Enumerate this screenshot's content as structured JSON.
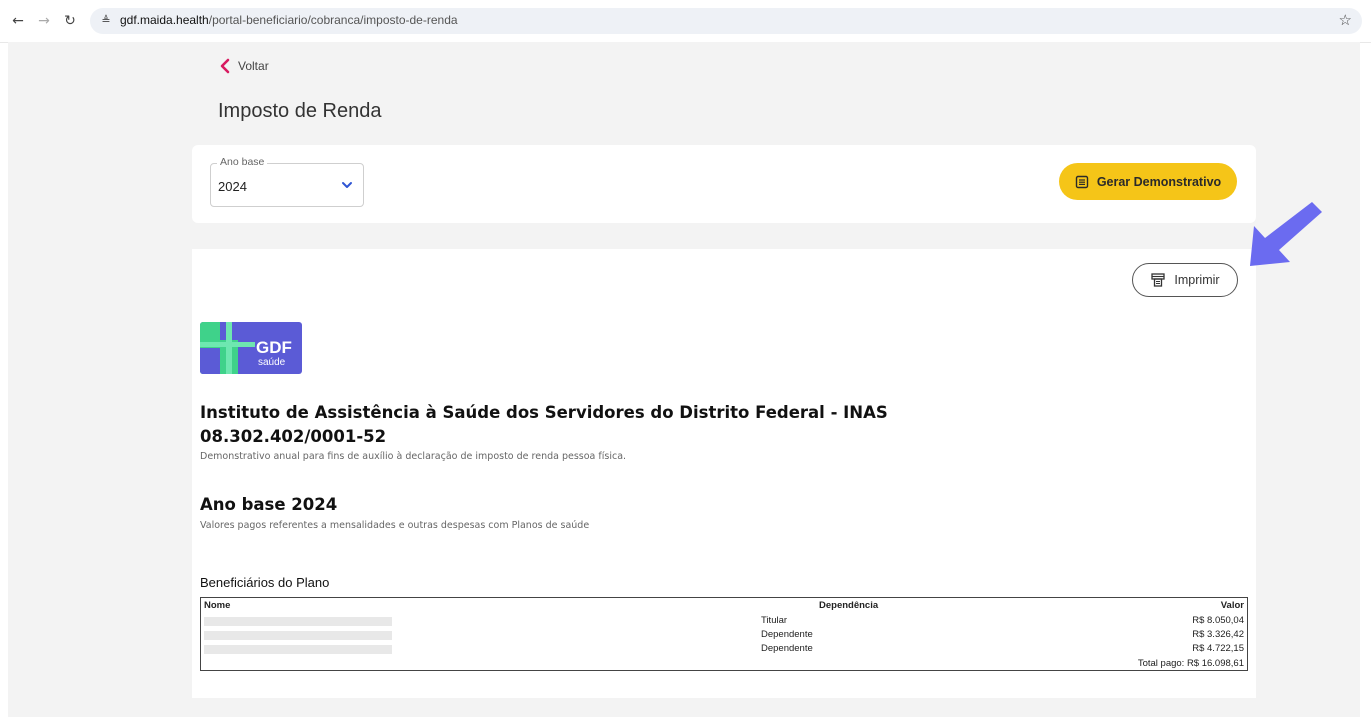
{
  "browser": {
    "url_host": "gdf.maida.health",
    "url_path": "/portal-beneficiario/cobranca/imposto-de-renda"
  },
  "page": {
    "back_label": "Voltar",
    "title": "Imposto de Renda"
  },
  "filter": {
    "select_label": "Ano base",
    "select_value": "2024",
    "generate_label": "Gerar Demonstrativo"
  },
  "document": {
    "print_label": "Imprimir",
    "logo_text_1": "GDF",
    "logo_text_2": "saúde",
    "institution_name": "Instituto de Assistência à Saúde dos Servidores do Distrito Federal - INAS",
    "cnpj": "08.302.402/0001-52",
    "description": "Demonstrativo anual para fins de auxílio à declaração de imposto de renda pessoa física.",
    "year_title": "Ano base 2024",
    "year_description": "Valores pagos referentes a mensalidades e outras despesas com Planos de saúde",
    "beneficiaries_title": "Beneficiários do Plano",
    "table": {
      "headers": [
        "Nome",
        "Dependência",
        "Valor"
      ],
      "rows": [
        {
          "name": "",
          "dependency": "Titular",
          "value": "R$ 8.050,04"
        },
        {
          "name": "",
          "dependency": "Dependente",
          "value": "R$ 3.326,42"
        },
        {
          "name": "",
          "dependency": "Dependente",
          "value": "R$ 4.722,15"
        }
      ],
      "total": "Total pago: R$ 16.098,61"
    }
  },
  "colors": {
    "accent_yellow": "#f5c518",
    "back_chevron": "#d81b60",
    "annotation_arrow": "#6b6bf0",
    "logo_bg": "#5b5bd6",
    "logo_green": "#3fd28a"
  }
}
